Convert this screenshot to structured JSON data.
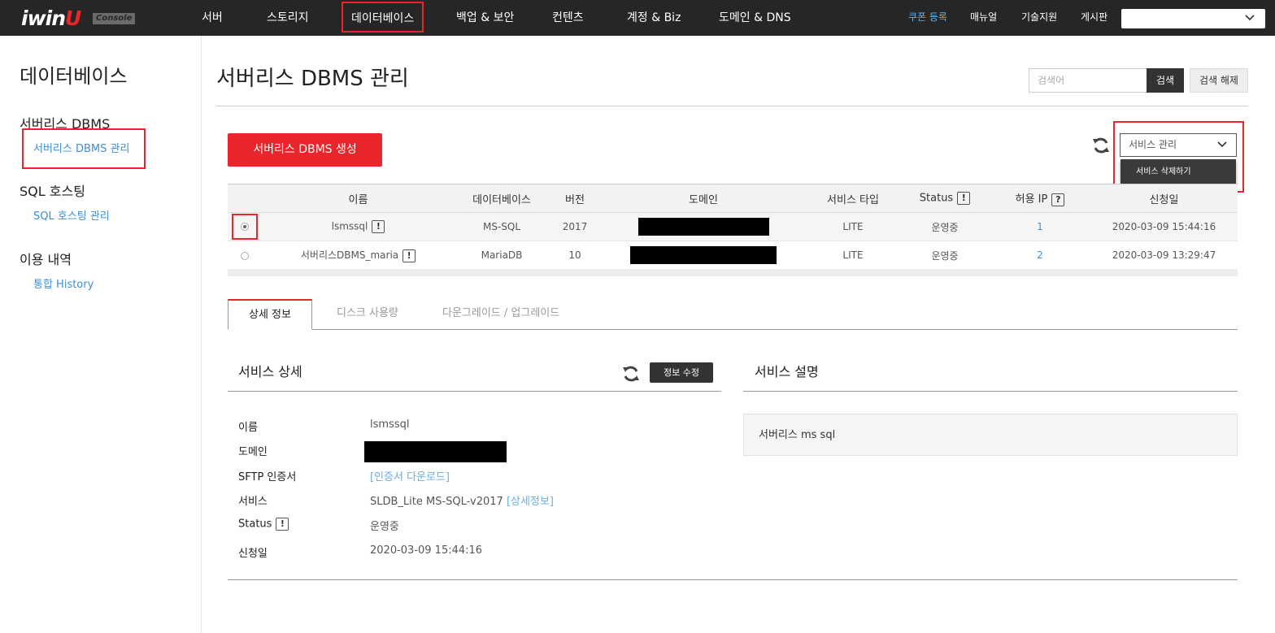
{
  "brand": {
    "logo_text": "iwin",
    "logo_smile": "U",
    "console_badge": "Console",
    "accent": "#e8262b",
    "link_color": "#3d8fd4"
  },
  "topnav": {
    "items": [
      "서버",
      "스토리지",
      "데이터베이스",
      "백업 & 보안",
      "컨텐츠",
      "계정 & Biz",
      "도메인 & DNS"
    ],
    "active": "데이터베이스",
    "utility": [
      "쿠폰 등록",
      "매뉴얼",
      "기술지원",
      "게시판"
    ],
    "account_select_value": ""
  },
  "sidebar": {
    "title": "데이터베이스",
    "groups": [
      {
        "label": "서버리스 DBMS",
        "links": [
          {
            "label": "서버리스 DBMS 관리",
            "active": true
          }
        ]
      },
      {
        "label": "SQL 호스팅",
        "links": [
          {
            "label": "SQL 호스팅 관리",
            "active": false
          }
        ]
      },
      {
        "label": "이용 내역",
        "links": [
          {
            "label": "통합 History",
            "active": false
          }
        ]
      }
    ]
  },
  "main": {
    "title": "서버리스 DBMS 관리",
    "search": {
      "placeholder": "검색어",
      "button": "검색",
      "clear": "검색 해제"
    },
    "create_button": "서버리스 DBMS 생성",
    "service_select": {
      "value": "서비스 관리",
      "menu_item": "서비스 삭제하기"
    },
    "table": {
      "headers": [
        "이름",
        "데이터베이스",
        "버전",
        "도메인",
        "서비스 타입",
        "Status",
        "허용 IP",
        "신청일"
      ],
      "status_badge": "!",
      "ip_badge": "?",
      "name_badge": "!",
      "rows": [
        {
          "selected": true,
          "name": "lsmssql",
          "database": "MS-SQL",
          "version": "2017",
          "service_type": "LITE",
          "status": "운영중",
          "allowed_ip": "1",
          "applied": "2020-03-09 15:44:16"
        },
        {
          "selected": false,
          "name": "서버리스DBMS_maria",
          "database": "MariaDB",
          "version": "10",
          "service_type": "LITE",
          "status": "운영중",
          "allowed_ip": "2",
          "applied": "2020-03-09 13:29:47"
        }
      ]
    },
    "tabs": [
      "상세 정보",
      "디스크 사용량",
      "다운그레이드 / 업그레이드"
    ],
    "detail": {
      "title": "서비스 상세",
      "edit_button": "정보 수정",
      "fields": {
        "name_label": "이름",
        "name_value": "lsmssql",
        "domain_label": "도메인",
        "sftp_label": "SFTP 인증서",
        "sftp_link": "[인증서 다운로드]",
        "service_label": "서비스",
        "service_value": "SLDB_Lite MS-SQL-v2017",
        "service_link": "[상세정보]",
        "status_label": "Status",
        "status_badge": "!",
        "status_value": "운영중",
        "applied_label": "신청일",
        "applied_value": "2020-03-09 15:44:16"
      }
    },
    "description": {
      "title": "서비스 설명",
      "text": "서버리스 ms sql"
    }
  }
}
